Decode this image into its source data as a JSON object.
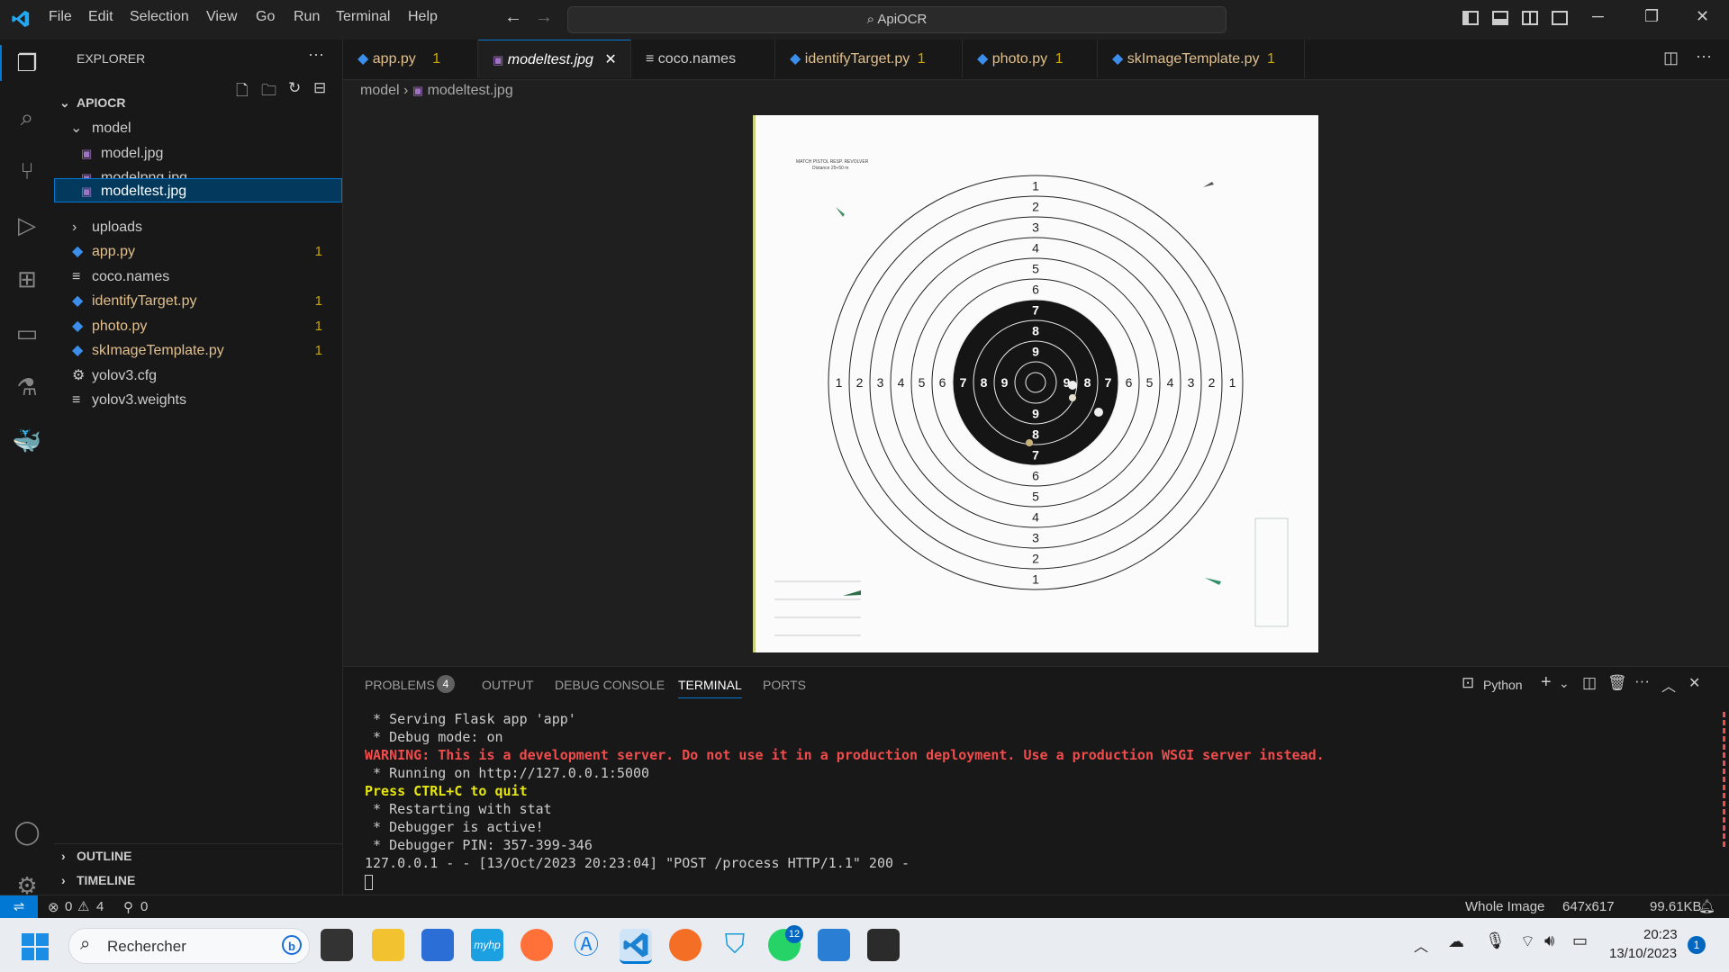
{
  "menu": [
    "File",
    "Edit",
    "Selection",
    "View",
    "Go",
    "Run",
    "Terminal",
    "Help"
  ],
  "search": "ApiOCR",
  "explorer": {
    "title": "EXPLORER",
    "root": "APIOCR",
    "items": [
      {
        "label": "model",
        "badge": ""
      },
      {
        "label": "model.jpg",
        "badge": ""
      },
      {
        "label": "modelpng.jpg",
        "badge": ""
      },
      {
        "label": "modeltest.jpg",
        "badge": ""
      },
      {
        "label": "uploads",
        "badge": ""
      },
      {
        "label": "app.py",
        "badge": "1"
      },
      {
        "label": "coco.names",
        "badge": ""
      },
      {
        "label": "identifyTarget.py",
        "badge": "1"
      },
      {
        "label": "photo.py",
        "badge": "1"
      },
      {
        "label": "skImageTemplate.py",
        "badge": "1"
      },
      {
        "label": "yolov3.cfg",
        "badge": ""
      },
      {
        "label": "yolov3.weights",
        "badge": ""
      }
    ],
    "outline": "OUTLINE",
    "timeline": "TIMELINE"
  },
  "tabs": [
    {
      "label": "app.py",
      "badge": "1"
    },
    {
      "label": "modeltest.jpg",
      "badge": ""
    },
    {
      "label": "coco.names",
      "badge": ""
    },
    {
      "label": "identifyTarget.py",
      "badge": "1"
    },
    {
      "label": "photo.py",
      "badge": "1"
    },
    {
      "label": "skImageTemplate.py",
      "badge": "1"
    }
  ],
  "breadcrumb": {
    "folder": "model",
    "file": "modeltest.jpg"
  },
  "target": {
    "ring_numbers": [
      "1",
      "2",
      "3",
      "4",
      "5",
      "6",
      "7",
      "8",
      "9"
    ],
    "header_line1": "MATCH PISTOL RESP. REVOLVER",
    "header_line2": "Distance 25+50 m"
  },
  "panel": {
    "tabs": [
      "PROBLEMS",
      "OUTPUT",
      "DEBUG CONSOLE",
      "TERMINAL",
      "PORTS"
    ],
    "problems_count": "4",
    "shell": "Python",
    "lines": [
      {
        "text": " * Serving Flask app 'app'",
        "color": "#cccccc"
      },
      {
        "text": " * Debug mode: on",
        "color": "#cccccc"
      },
      {
        "text": "WARNING: This is a development server. Do not use it in a production deployment. Use a production WSGI server instead.",
        "color": "#f14c4c"
      },
      {
        "text": " * Running on http://127.0.0.1:5000",
        "color": "#cccccc"
      },
      {
        "text": "Press CTRL+C to quit",
        "color": "#e5e510"
      },
      {
        "text": " * Restarting with stat",
        "color": "#cccccc"
      },
      {
        "text": " * Debugger is active!",
        "color": "#cccccc"
      },
      {
        "text": " * Debugger PIN: 357-399-346",
        "color": "#cccccc"
      },
      {
        "text": "127.0.0.1 - - [13/Oct/2023 20:23:04] \"POST /process HTTP/1.1\" 200 -",
        "color": "#cccccc"
      }
    ]
  },
  "status": {
    "errors": "0",
    "warnings": "4",
    "ports": "0",
    "view": "Whole Image",
    "dims": "647x617",
    "size": "99.61KB"
  },
  "taskbar": {
    "search": "Rechercher",
    "time": "20:23",
    "date": "13/10/2023",
    "notif": "1",
    "whatsapp_badge": "12",
    "settings_badge": "1"
  }
}
